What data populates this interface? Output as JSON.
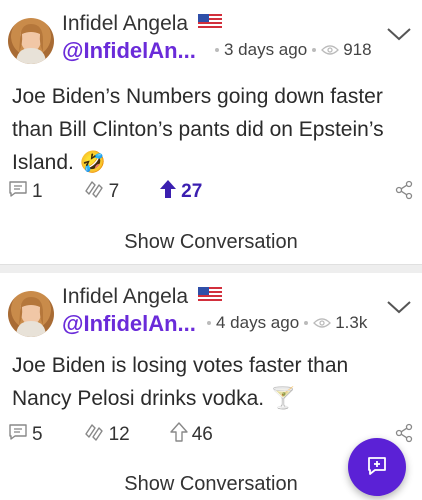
{
  "posts": [
    {
      "author": "Infidel Angela",
      "handle": "@InfidelAn...",
      "time": "3 days ago",
      "views": "918",
      "text": "Joe Biden’s Numbers going down faster than Bill Clinton’s pants did on Epstein’s Island. 🤣",
      "comments": "1",
      "reposts": "7",
      "upvotes": "27",
      "upvoted": true,
      "show_conversation": "Show Conversation"
    },
    {
      "author": "Infidel Angela",
      "handle": "@InfidelAn...",
      "time": "4 days ago",
      "views": "1.3k",
      "text": "Joe Biden is losing votes faster than Nancy Pelosi drinks vodka. 🍸",
      "comments": "5",
      "reposts": "12",
      "upvotes": "46",
      "upvoted": false,
      "show_conversation": "Show Conversation"
    }
  ],
  "icons": {
    "flag": "us-flag-icon",
    "views": "eye-icon",
    "menu": "chevron-down-icon",
    "comment": "comment-icon",
    "repost": "repost-icon",
    "upvote": "upvote-arrow-icon",
    "share": "share-icon",
    "compose": "compose-icon"
  },
  "colors": {
    "handle": "#6a2bd9",
    "upvoted": "#3b1fb0",
    "fab": "#5b21d6"
  }
}
